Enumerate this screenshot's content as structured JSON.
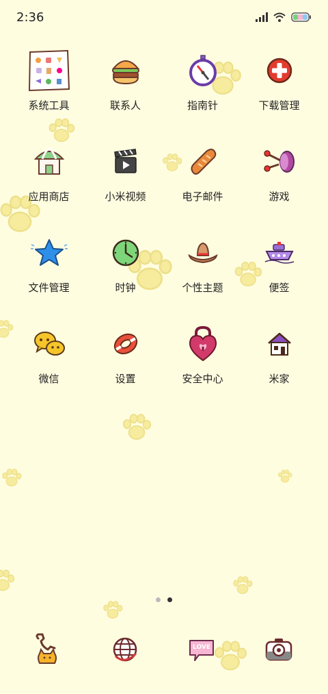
{
  "status": {
    "time": "2:36"
  },
  "apps": [
    {
      "label": "系统工具",
      "icon": "system-tools-folder-icon"
    },
    {
      "label": "联系人",
      "icon": "burger-contacts-icon"
    },
    {
      "label": "指南针",
      "icon": "compass-icon"
    },
    {
      "label": "下载管理",
      "icon": "download-plus-icon"
    },
    {
      "label": "应用商店",
      "icon": "shop-icon"
    },
    {
      "label": "小米视频",
      "icon": "clapperboard-icon"
    },
    {
      "label": "电子邮件",
      "icon": "bread-icon"
    },
    {
      "label": "游戏",
      "icon": "drum-game-icon"
    },
    {
      "label": "文件管理",
      "icon": "star-icon"
    },
    {
      "label": "时钟",
      "icon": "clock-icon"
    },
    {
      "label": "个性主题",
      "icon": "hat-icon"
    },
    {
      "label": "便签",
      "icon": "boat-icon"
    },
    {
      "label": "微信",
      "icon": "chat-bubbles-icon"
    },
    {
      "label": "设置",
      "icon": "lifebuoy-icon"
    },
    {
      "label": "安全中心",
      "icon": "heart-lock-icon"
    },
    {
      "label": "米家",
      "icon": "house-icon"
    }
  ],
  "dock": [
    {
      "name": "phone-dock",
      "icon": "phone-cat-icon"
    },
    {
      "name": "browser-dock",
      "icon": "globe-icon"
    },
    {
      "name": "messages-dock",
      "icon": "love-bubble-icon",
      "text": "LOVE"
    },
    {
      "name": "camera-dock",
      "icon": "camera-icon"
    }
  ],
  "pager": {
    "pages": 2,
    "current": 2
  }
}
